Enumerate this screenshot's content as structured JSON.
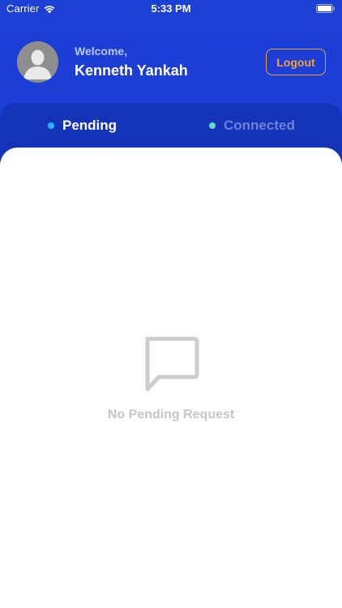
{
  "status_bar": {
    "carrier": "Carrier",
    "time": "5:33 PM"
  },
  "header": {
    "welcome": "Welcome,",
    "username": "Kenneth Yankah",
    "logout_label": "Logout"
  },
  "tabs": [
    {
      "label": "Pending",
      "active": true
    },
    {
      "label": "Connected",
      "active": false
    }
  ],
  "empty_state": {
    "icon": "chat-bubble-icon",
    "message": "No Pending Request"
  },
  "colors": {
    "background": "#1c3fd6",
    "accent": "#f3a23a",
    "pending_dot": "#27b7ff",
    "connected_dot": "#5fe0c4"
  }
}
